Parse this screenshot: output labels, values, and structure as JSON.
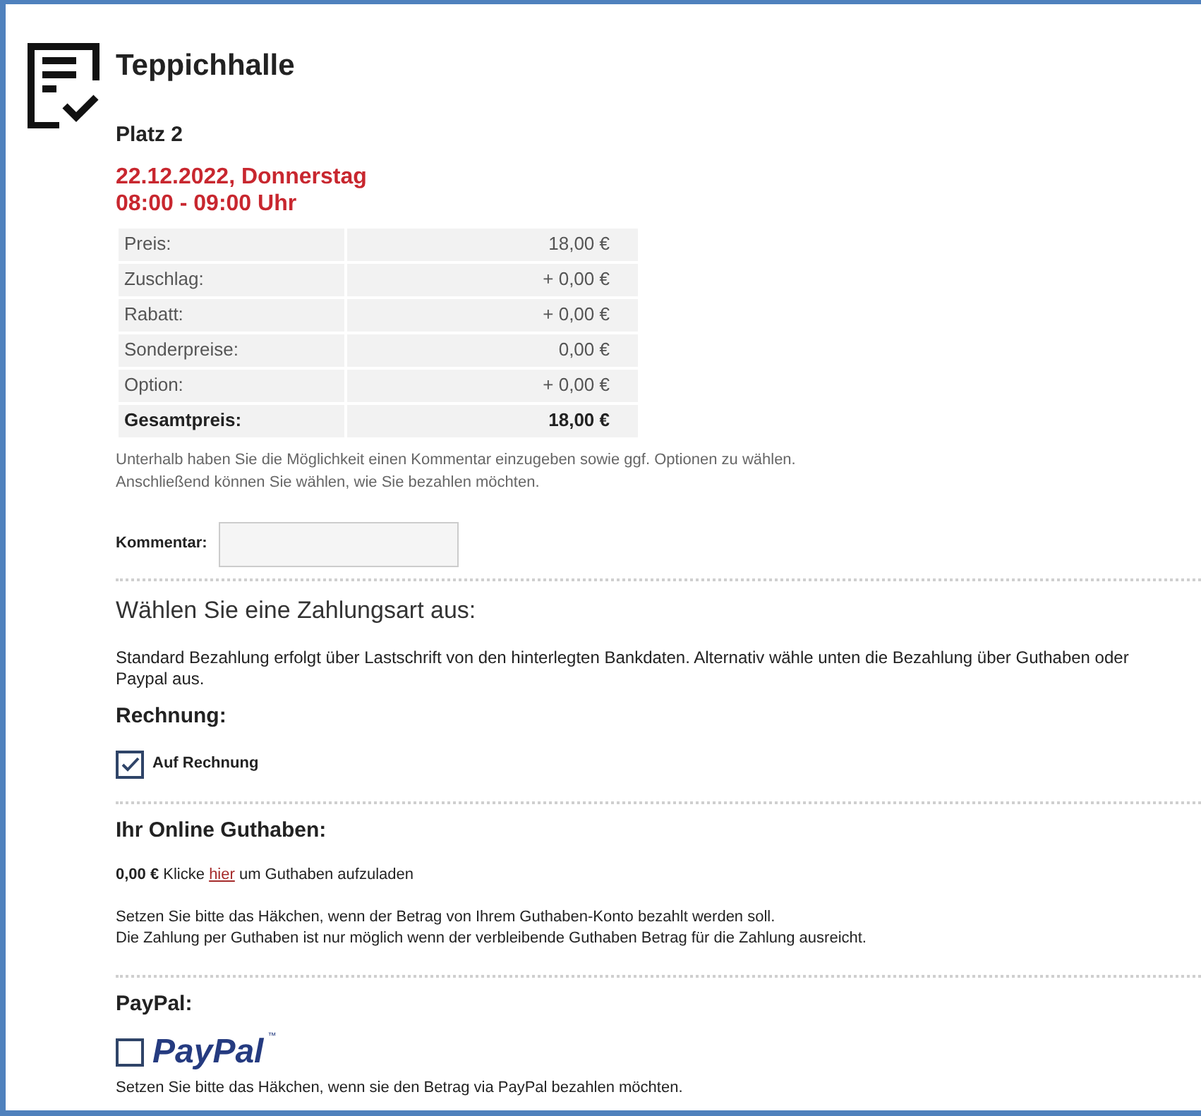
{
  "title": "Teppichhalle",
  "court": "Platz 2",
  "date": "22.12.2022, Donnerstag",
  "time": "08:00 - 09:00 Uhr",
  "price_table": [
    {
      "label": "Preis:",
      "value": "18,00 €",
      "total": false
    },
    {
      "label": "Zuschlag:",
      "value": "+ 0,00 €",
      "total": false
    },
    {
      "label": "Rabatt:",
      "value": "+ 0,00 €",
      "total": false
    },
    {
      "label": "Sonderpreise:",
      "value": "0,00 €",
      "total": false
    },
    {
      "label": "Option:",
      "value": "+ 0,00 €",
      "total": false
    },
    {
      "label": "Gesamtpreis:",
      "value": "18,00 €",
      "total": true
    }
  ],
  "note": [
    "Unterhalb haben Sie die Möglichkeit einen Kommentar einzugeben sowie ggf. Optionen zu wählen.",
    "Anschließend können Sie wählen, wie Sie bezahlen möchten."
  ],
  "comment": {
    "label": "Kommentar:"
  },
  "payment_heading": "Wählen Sie eine Zahlungsart aus:",
  "payment_intro": "Standard Bezahlung erfolgt über Lastschrift von den hinterlegten Bankdaten. Alternativ wähle unten die Bezahlung über Guthaben oder Paypal aus.",
  "invoice": {
    "heading": "Rechnung:",
    "checkbox": {
      "label": "Auf Rechnung",
      "checked": true
    }
  },
  "credit": {
    "heading": "Ihr Online Guthaben:",
    "balance": "0,00 €",
    "before_link": "Klicke",
    "link": "hier",
    "after_link": "um Guthaben aufzuladen",
    "info": [
      "Setzen Sie bitte das Häkchen, wenn der Betrag von Ihrem Guthaben-Konto bezahlt werden soll.",
      "Die Zahlung per Guthaben ist nur möglich wenn der verbleibende Guthaben Betrag für die Zahlung ausreicht."
    ]
  },
  "paypal": {
    "heading": "PayPal:",
    "checked": false,
    "logo_text": "PayPal",
    "logo_mark": "™",
    "info": "Setzen Sie bitte das Häkchen, wenn sie den Betrag via PayPal bezahlen möchten."
  }
}
